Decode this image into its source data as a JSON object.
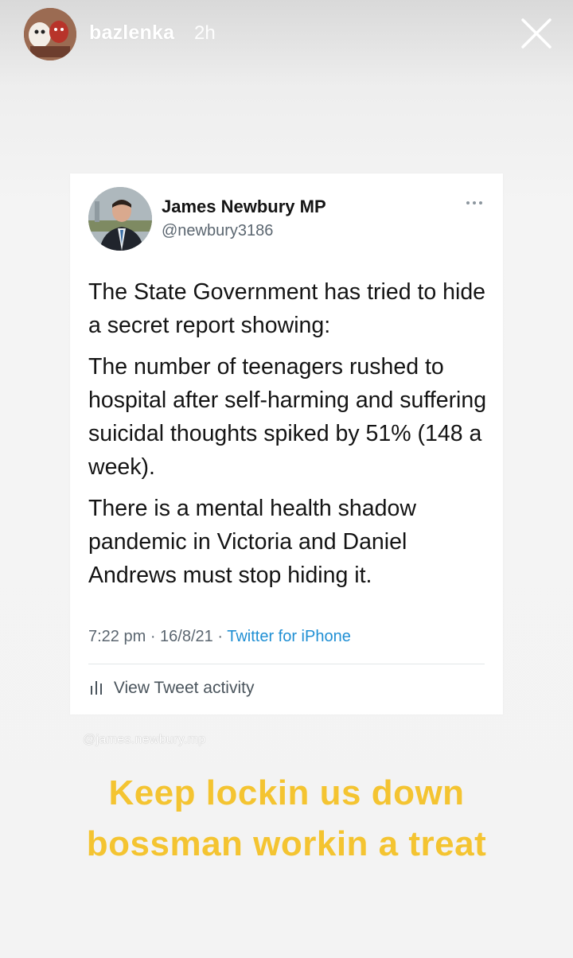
{
  "story": {
    "username": "bazlenka",
    "timestamp": "2h",
    "close_icon": "close-icon",
    "mention": "@james.newbury.mp",
    "caption": "Keep lockin us down bossman workin a treat",
    "caption_color": "#f4c431"
  },
  "tweet": {
    "author_name": "James Newbury MP",
    "handle": "@newbury3186",
    "more_icon": "more-options-icon",
    "paragraphs": [
      "The State Government has tried to hide a secret report showing:",
      "The number of teenagers rushed to hospital after self-harming and suffering suicidal thoughts spiked by 51% (148 a week).",
      "There is a mental health shadow pandemic in Victoria and Daniel Andrews must stop hiding it."
    ],
    "time": "7:22 pm",
    "date": "16/8/21",
    "source": "Twitter for iPhone",
    "source_color": "#1f8fd4",
    "activity_label": "View Tweet activity",
    "activity_icon": "bar-chart-icon"
  }
}
